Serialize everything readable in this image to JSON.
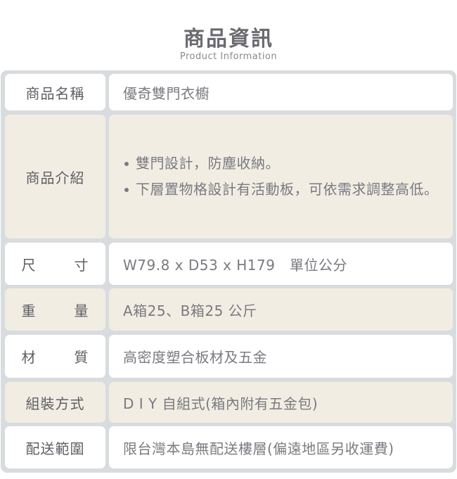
{
  "header": {
    "title": "商品資訊",
    "subtitle": "Product Information"
  },
  "rows": [
    {
      "label": "商品名稱",
      "value": "優奇雙門衣櫥",
      "bg": "white"
    },
    {
      "label": "商品介紹",
      "bullets": [
        "雙門設計，防塵收納。",
        "下層置物格設計有活動板，可依需求調整高低。"
      ],
      "bg": "beige"
    },
    {
      "label_chars": [
        "尺",
        "寸"
      ],
      "label": "尺寸",
      "value": "W79.8 x D53 x H179　單位公分",
      "bg": "white"
    },
    {
      "label_chars": [
        "重",
        "量"
      ],
      "label": "重量",
      "value": "A箱25、B箱25 公斤",
      "bg": "beige"
    },
    {
      "label_chars": [
        "材",
        "質"
      ],
      "label": "材質",
      "value": "高密度塑合板材及五金",
      "bg": "white"
    },
    {
      "label": "組裝方式",
      "value": "D I Y 自組式(箱內附有五金包)",
      "bg": "beige"
    },
    {
      "label": "配送範圍",
      "value": "限台灣本島無配送樓層(偏遠地區另收運費)",
      "bg": "white"
    }
  ],
  "colors": {
    "frame": "#d9dcde",
    "row_white": "#ffffff",
    "row_beige": "#f1ede3",
    "label_text": "#5e5e64",
    "value_text": "#7a7a80"
  }
}
